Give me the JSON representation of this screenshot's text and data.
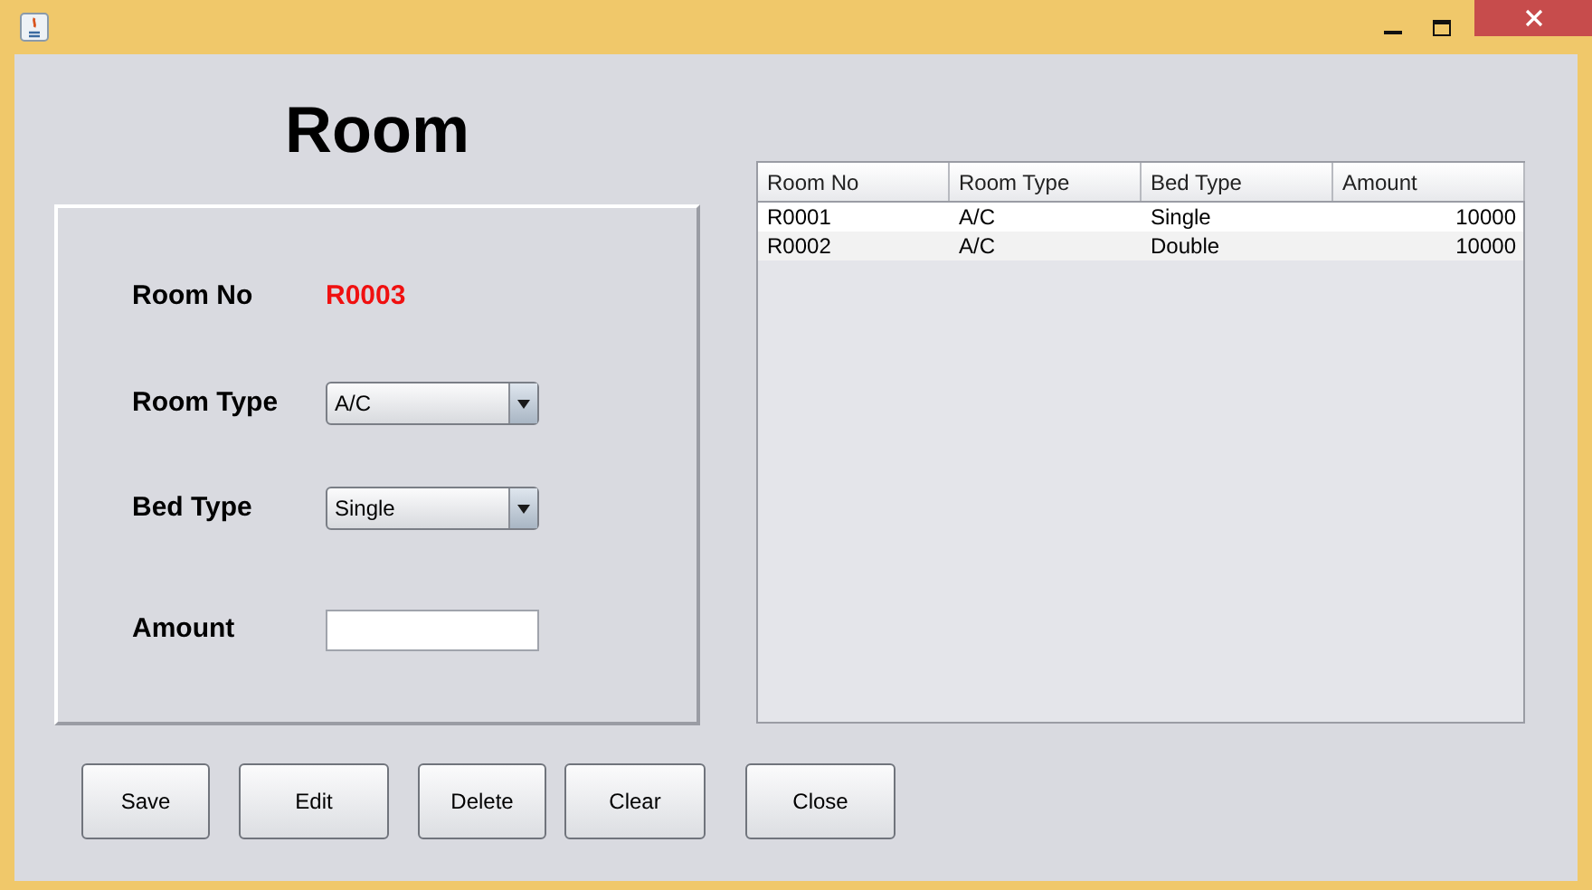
{
  "heading": "Room",
  "form": [
    {
      "kind": "text",
      "label": "Room No",
      "value": "R0003"
    },
    {
      "kind": "combo",
      "label": "Room Type",
      "value": "A/C"
    },
    {
      "kind": "combo",
      "label": "Bed Type",
      "value": "Single"
    },
    {
      "kind": "input",
      "label": "Amount"
    }
  ],
  "table": {
    "columns": [
      "Room No",
      "Room Type",
      "Bed Type",
      "Amount"
    ],
    "rows": [
      [
        "R0001",
        "A/C",
        "Single",
        "10000"
      ],
      [
        "R0002",
        "A/C",
        "Double",
        "10000"
      ]
    ]
  },
  "buttons": [
    "Save",
    "Edit",
    "Delete",
    "Clear",
    "Close"
  ]
}
